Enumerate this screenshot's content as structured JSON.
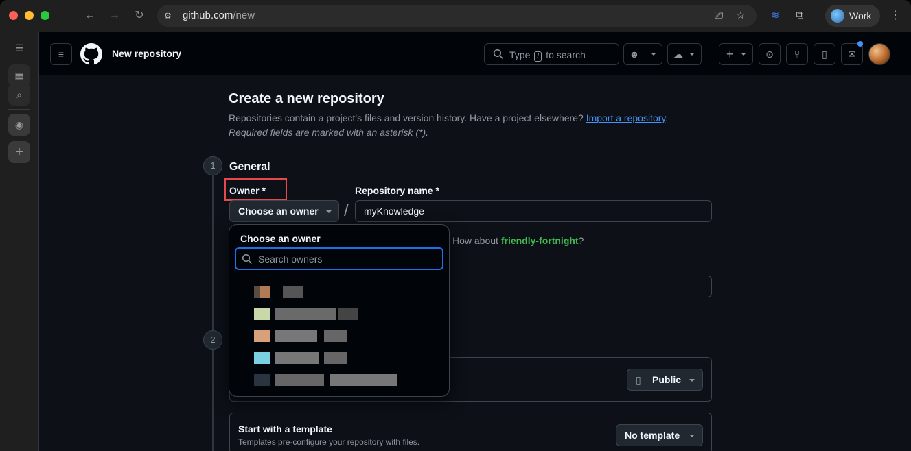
{
  "browser": {
    "url_host": "github.com",
    "url_path": "/new",
    "profile_name": "Work",
    "icons": [
      "back-icon",
      "forward-icon",
      "reload-icon",
      "site-settings-icon",
      "install-app-icon",
      "bookmark-star-icon",
      "extension-icon",
      "puzzle-icon",
      "more-icon"
    ]
  },
  "sidebar": {
    "icons": [
      "collapse-sidebar-icon",
      "tabs-grid-icon",
      "search-tabs-icon",
      "github-tab-icon",
      "new-tab-plus-icon"
    ]
  },
  "header": {
    "title": "New repository",
    "search_prefix": "Type",
    "search_key": "/",
    "search_suffix": "to search"
  },
  "main": {
    "title": "Create a new repository",
    "description": "Repositories contain a project's files and version history. Have a project elsewhere?",
    "import_link": "Import a repository",
    "description_end": ".",
    "required_note": "Required fields are marked with an asterisk (*).",
    "steps": [
      "1",
      "2"
    ],
    "section_general": "General",
    "owner_label": "Owner *",
    "owner_button": "Choose an owner",
    "repo_label": "Repository name *",
    "repo_value": "myKnowledge",
    "suggest_prefix": "How about",
    "suggest_name": "friendly-fortnight",
    "suggest_suffix": "?",
    "visibility_value": "Public",
    "template_title": "Start with a template",
    "template_desc": "Templates pre-configure your repository with files.",
    "template_value": "No template"
  },
  "dropdown": {
    "title": "Choose an owner",
    "search_placeholder": "Search owners"
  },
  "colors": {
    "accent_blue": "#4493f8",
    "focus_blue": "#1f6feb",
    "suggest_green": "#3fb950",
    "highlight_red": "#e5484d",
    "bg": "#0d1117"
  }
}
